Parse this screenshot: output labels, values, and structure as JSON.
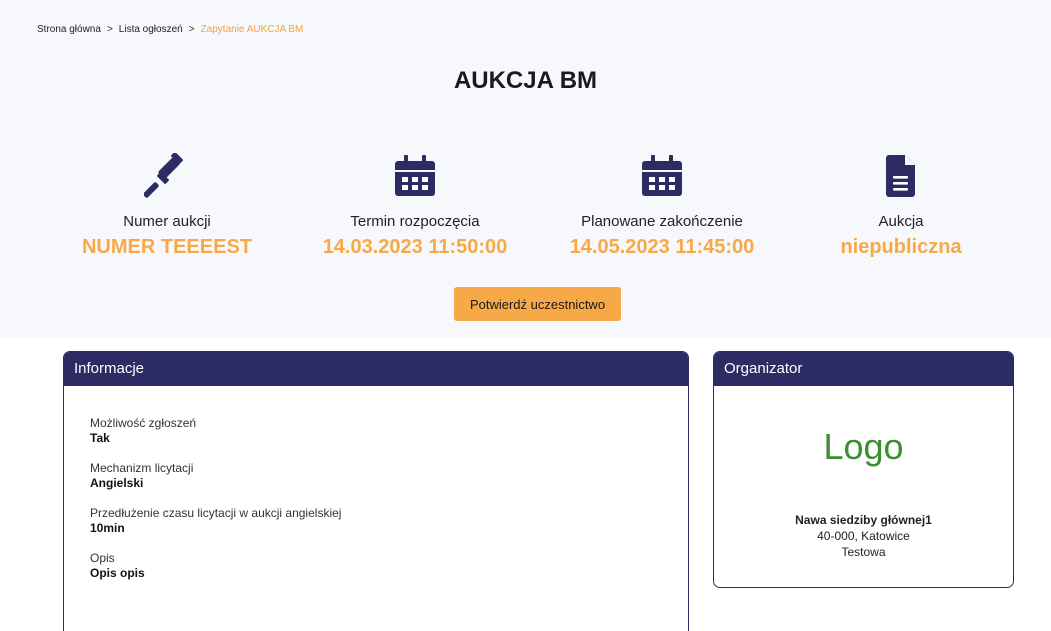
{
  "breadcrumb": {
    "items": [
      "Strona główna",
      "Lista ogłoszeń"
    ],
    "current": "Zapytanie AUKCJA BM",
    "separator": ">"
  },
  "page": {
    "title": "AUKCJA BM"
  },
  "stats": [
    {
      "icon": "gavel-icon",
      "label": "Numer aukcji",
      "value": "NUMER TEEEEST"
    },
    {
      "icon": "calendar-icon",
      "label": "Termin rozpoczęcia",
      "value": "14.03.2023 11:50:00"
    },
    {
      "icon": "calendar-icon",
      "label": "Planowane zakończenie",
      "value": "14.05.2023 11:45:00"
    },
    {
      "icon": "document-icon",
      "label": "Aukcja",
      "value": "niepubliczna"
    }
  ],
  "actions": {
    "confirm_label": "Potwierdź uczestnictwo"
  },
  "info": {
    "title": "Informacje",
    "items": [
      {
        "key": "Możliwość zgłoszeń",
        "value": "Tak"
      },
      {
        "key": "Mechanizm licytacji",
        "value": "Angielski"
      },
      {
        "key": "Przedłużenie czasu licytacji w aukcji angielskiej",
        "value": "10min"
      },
      {
        "key": "Opis",
        "value": "Opis opis"
      }
    ]
  },
  "organizer": {
    "title": "Organizator",
    "logo_text": "Logo",
    "name": "Nawa siedziby głównej1",
    "postal_city": "40-000, Katowice",
    "extra": "Testowa"
  },
  "colors": {
    "accent": "#f7a948",
    "navy": "#2c2b63",
    "logo_green": "#3a8f2e"
  }
}
